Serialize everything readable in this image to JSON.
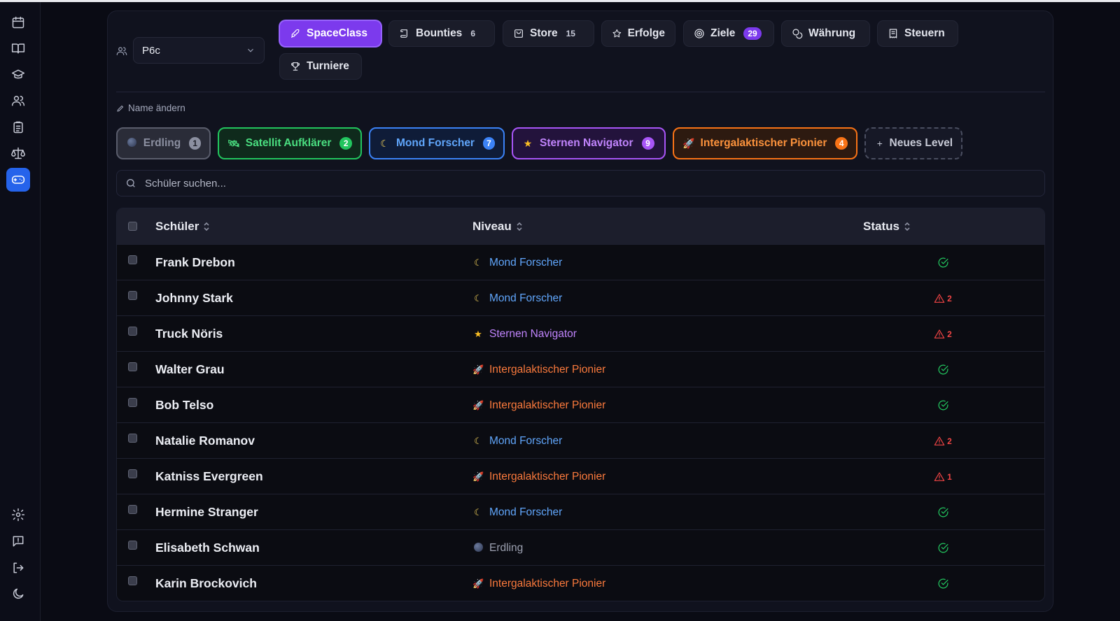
{
  "class_selector": {
    "value": "P6c"
  },
  "tabs": [
    {
      "label": "SpaceClass",
      "count": ""
    },
    {
      "label": "Bounties",
      "count": "6"
    },
    {
      "label": "Store",
      "count": "15"
    },
    {
      "label": "Erfolge",
      "count": ""
    },
    {
      "label": "Ziele",
      "count": "29"
    },
    {
      "label": "Währung",
      "count": ""
    },
    {
      "label": "Steuern",
      "count": ""
    },
    {
      "label": "Turniere",
      "count": ""
    }
  ],
  "rename_label": "Name ändern",
  "levels": [
    {
      "label": "Erdling",
      "count": "1"
    },
    {
      "label": "Satellit Aufklärer",
      "count": "2"
    },
    {
      "label": "Mond Forscher",
      "count": "7"
    },
    {
      "label": "Sternen Navigator",
      "count": "9"
    },
    {
      "label": "Intergalaktischer Pionier",
      "count": "4"
    }
  ],
  "new_level_label": "Neues Level",
  "search": {
    "placeholder": "Schüler suchen..."
  },
  "table": {
    "headers": {
      "student": "Schüler",
      "level": "Niveau",
      "status": "Status"
    },
    "rows": [
      {
        "name": "Frank Drebon",
        "level": "Mond Forscher",
        "status": "ok",
        "warnings": ""
      },
      {
        "name": "Johnny Stark",
        "level": "Mond Forscher",
        "status": "warn",
        "warnings": "2"
      },
      {
        "name": "Truck Nöris",
        "level": "Sternen Navigator",
        "status": "warn",
        "warnings": "2"
      },
      {
        "name": "Walter Grau",
        "level": "Intergalaktischer Pionier",
        "status": "ok",
        "warnings": ""
      },
      {
        "name": "Bob Telso",
        "level": "Intergalaktischer Pionier",
        "status": "ok",
        "warnings": ""
      },
      {
        "name": "Natalie Romanov",
        "level": "Mond Forscher",
        "status": "warn",
        "warnings": "2"
      },
      {
        "name": "Katniss Evergreen",
        "level": "Intergalaktischer Pionier",
        "status": "warn",
        "warnings": "1"
      },
      {
        "name": "Hermine Stranger",
        "level": "Mond Forscher",
        "status": "ok",
        "warnings": ""
      },
      {
        "name": "Elisabeth Schwan",
        "level": "Erdling",
        "status": "ok",
        "warnings": ""
      },
      {
        "name": "Karin Brockovich",
        "level": "Intergalaktischer Pionier",
        "status": "ok",
        "warnings": ""
      }
    ]
  },
  "colors": {
    "accent": "#7c3aed",
    "sidebar_active": "#2563eb",
    "erdling": "#8b8fa0",
    "satellit": "#22c55e",
    "mond": "#3b82f6",
    "sternen": "#a855f7",
    "pionier": "#f97316",
    "ok": "#22c55e",
    "warn": "#ef4444"
  }
}
